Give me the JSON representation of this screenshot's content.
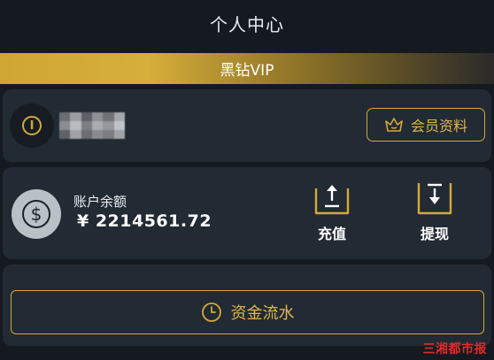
{
  "header": {
    "title": "个人中心"
  },
  "vip_banner": {
    "label": "黑钻VIP"
  },
  "profile": {
    "avatar_icon": "info-icon",
    "member_button_label": "会员资料",
    "member_button_icon": "crown-icon"
  },
  "balance": {
    "title": "账户余额",
    "amount": "¥ 2214561.72",
    "icon": "dollar-coin-icon",
    "actions": [
      {
        "label": "充值",
        "icon": "upload-tray-icon"
      },
      {
        "label": "提现",
        "icon": "download-tray-icon"
      }
    ]
  },
  "fund_flow": {
    "label": "资金流水",
    "icon": "clock-icon"
  },
  "watermark": "三湘都市报",
  "colors": {
    "background": "#151a21",
    "card": "#222a33",
    "gold": "#d4a93a",
    "gold_text": "#e2b74a",
    "watermark": "#e02b27"
  }
}
